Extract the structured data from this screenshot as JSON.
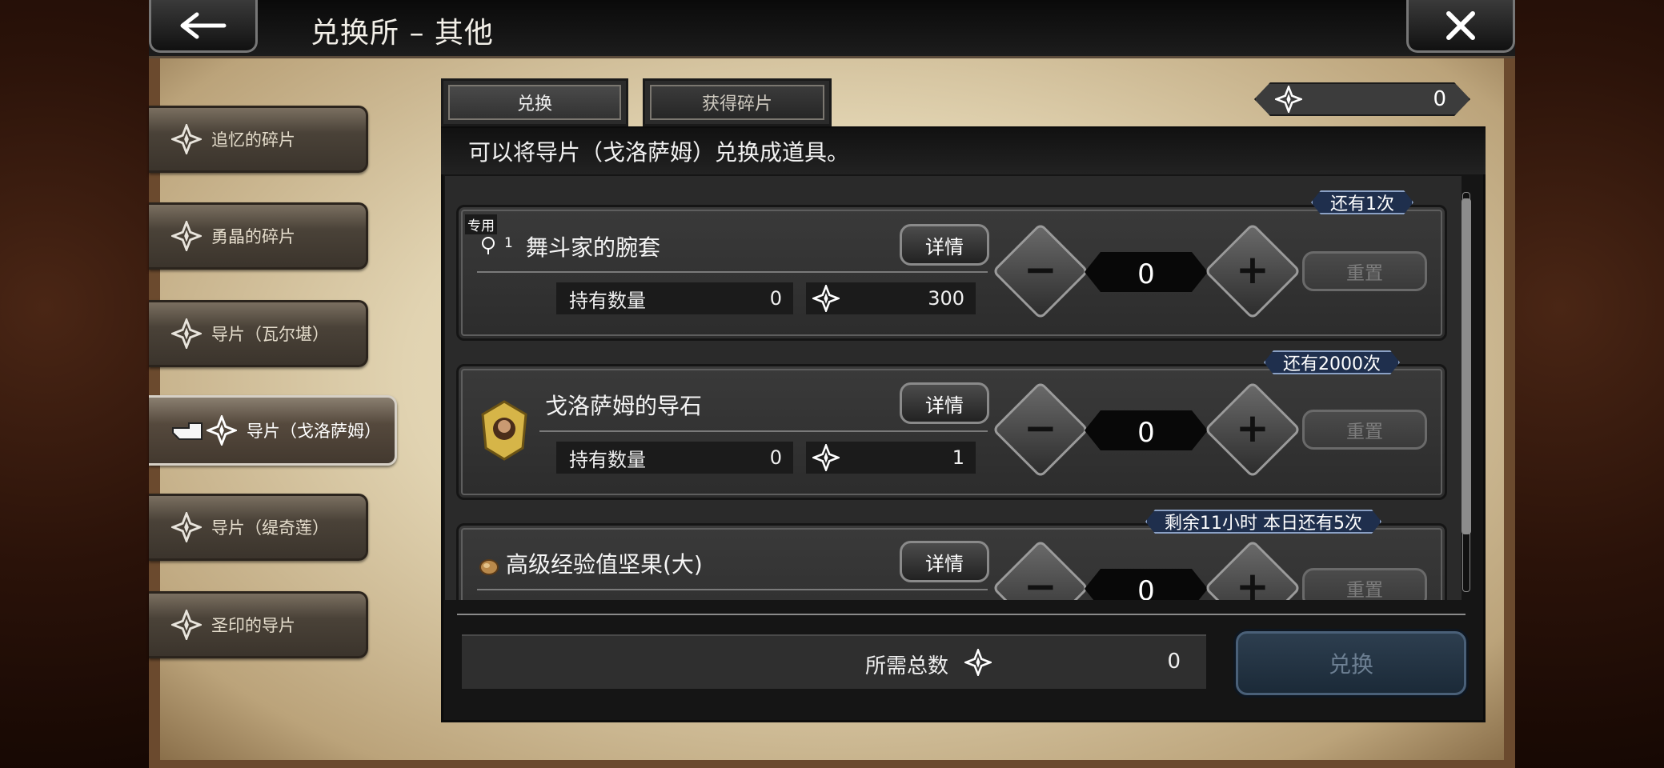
{
  "header": {
    "title": "兑换所 – 其他"
  },
  "sidebar": {
    "items": [
      {
        "label": "追忆的碎片",
        "active": false
      },
      {
        "label": "勇晶的碎片",
        "active": false
      },
      {
        "label": "导片（瓦尔堪）",
        "active": false
      },
      {
        "label": "导片（戈洛萨姆）",
        "active": true
      },
      {
        "label": "导片（缇奇莲）",
        "active": false
      },
      {
        "label": "圣印的导片",
        "active": false
      }
    ]
  },
  "tabs": [
    {
      "label": "兑换",
      "active": true
    },
    {
      "label": "获得碎片",
      "active": false
    }
  ],
  "currency": {
    "icon": "shard-icon",
    "value": "0"
  },
  "description": "可以将导片（戈洛萨姆）兑换成道具。",
  "items": [
    {
      "name": "舞斗家的腕套",
      "exclusive_label": "专用",
      "exclusive_count": "1",
      "limit": "还有1次",
      "detail_label": "详情",
      "owned_label": "持有数量",
      "owned": "0",
      "cost": "300",
      "quantity": "0",
      "reset_label": "重置"
    },
    {
      "name": "戈洛萨姆的导石",
      "limit": "还有2000次",
      "detail_label": "详情",
      "owned_label": "持有数量",
      "owned": "0",
      "cost": "1",
      "quantity": "0",
      "reset_label": "重置"
    },
    {
      "name": "高级经验值坚果(大)",
      "limit": "剩余11小时  本日还有5次",
      "detail_label": "详情",
      "quantity": "0",
      "reset_label": "重置"
    }
  ],
  "footer": {
    "total_label": "所需总数",
    "total_value": "0",
    "exchange_label": "兑换"
  },
  "colors": {
    "panel": "#2b2b2b",
    "badge": "#1f2f4d",
    "exchange_button": "#2d3e4f",
    "parchment": "#e1d3b1"
  }
}
